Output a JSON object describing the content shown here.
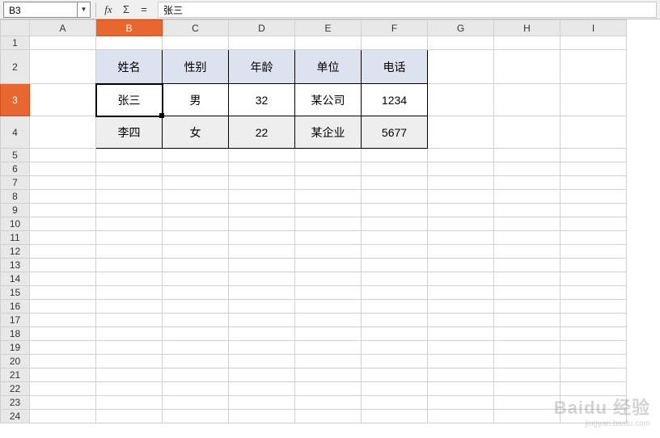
{
  "formula_bar": {
    "cell_ref": "B3",
    "fx_label": "fx",
    "sigma_label": "Σ",
    "equals_label": "=",
    "formula_value": "张三"
  },
  "columns": [
    "A",
    "B",
    "C",
    "D",
    "E",
    "F",
    "G",
    "H",
    "I"
  ],
  "col_widths": {
    "A": 82,
    "B": 82,
    "C": 82,
    "D": 82,
    "E": 82,
    "F": 82,
    "G": 82,
    "H": 82,
    "I": 82
  },
  "rows": [
    1,
    2,
    3,
    4,
    5,
    6,
    7,
    8,
    9,
    10,
    11,
    12,
    13,
    14,
    15,
    16,
    17,
    18,
    19,
    20,
    21,
    22,
    23,
    24
  ],
  "active_cell": "B3",
  "table": {
    "header": {
      "B": "姓名",
      "C": "性别",
      "D": "年龄",
      "E": "单位",
      "F": "电话"
    },
    "row3": {
      "B": "张三",
      "C": "男",
      "D": "32",
      "E": "某公司",
      "F": "1234"
    },
    "row4": {
      "B": "李四",
      "C": "女",
      "D": "22",
      "E": "某企业",
      "F": "5677"
    }
  },
  "row_heights": {
    "2": 42,
    "3": 40,
    "4": 40
  },
  "watermark": {
    "main": "Baidu 经验",
    "sub": "jingyan.baidu.com"
  }
}
